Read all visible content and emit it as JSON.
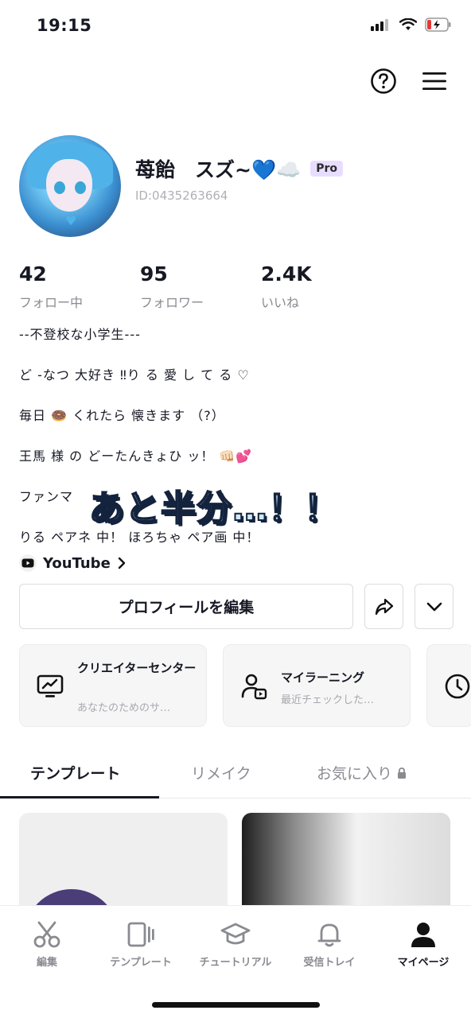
{
  "status_bar": {
    "time": "19:15"
  },
  "profile": {
    "name": "苺飴　スズ~💙☁️",
    "pro_badge": "Pro",
    "id": "ID:0435263664"
  },
  "stats": [
    {
      "value": "42",
      "label": "フォロー中"
    },
    {
      "value": "95",
      "label": "フォロワー"
    },
    {
      "value": "2.4K",
      "label": "いいね"
    }
  ],
  "bio": [
    "--不登校な小学生---",
    "ど  -なつ   大好き   ‼り    る    愛    し    て    る   ♡",
    "毎日   🍩    くれたら    懐きます     （?）",
    "王馬    様    の    どーたんきょひ   ッ！   👊🏻💕",
    "ファンマ   ",
    "りる   ペアネ   中！   ほろちゃ   ペア画   中！"
  ],
  "overlay_text": "あと半分…！！",
  "youtube_label": "YouTube",
  "edit_profile_label": "プロフィールを編集",
  "cards": [
    {
      "title": "クリエイターセンター",
      "subtitle": "あなたのためのサ…"
    },
    {
      "title": "マイラーニング",
      "subtitle": "最近チェックした…"
    }
  ],
  "tabs": [
    {
      "label": "テンプレート"
    },
    {
      "label": "リメイク"
    },
    {
      "label": "お気に入り"
    }
  ],
  "nav": [
    {
      "label": "編集"
    },
    {
      "label": "テンプレート"
    },
    {
      "label": "チュートリアル"
    },
    {
      "label": "受信トレイ"
    },
    {
      "label": "マイページ"
    }
  ],
  "icons": {
    "help": "help-circle-icon",
    "menu": "hamburger-menu-icon",
    "share": "share-arrow-icon",
    "more": "chevron-down-icon",
    "creator": "monitor-chart-icon",
    "learning": "person-play-icon",
    "history": "clock-icon",
    "lock": "lock-icon"
  }
}
